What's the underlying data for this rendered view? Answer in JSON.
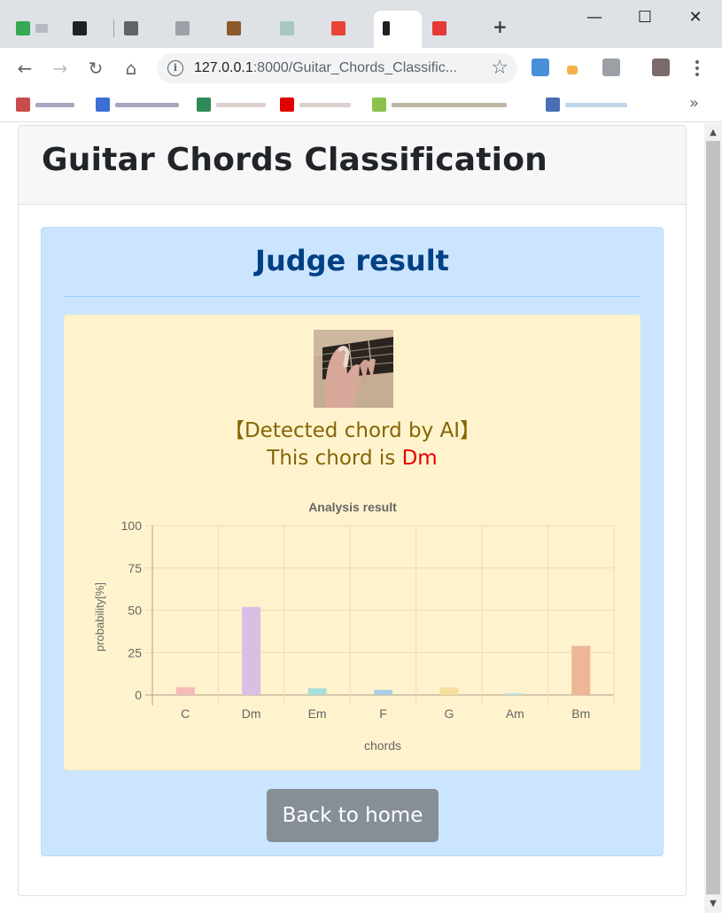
{
  "browser": {
    "url_host": "127.0.0.1",
    "url_rest": ":8000/Guitar_Chords_Classific...",
    "window_controls": [
      "minimize",
      "maximize",
      "close"
    ],
    "window_symbols": {
      "minimize": "—",
      "maximize": "☐",
      "close": "✕"
    },
    "nav_symbols": {
      "back": "←",
      "forward": "→",
      "reload": "↻",
      "home": "⌂",
      "star": "☆",
      "info": "i",
      "more": "»",
      "new_tab": "+"
    }
  },
  "page": {
    "title": "Guitar Chords Classification",
    "result_heading": "Judge result",
    "detected_label": "【Detected chord by AI】",
    "detected_prefix": "This chord is ",
    "detected_chord": "Dm",
    "home_button": "Back to home"
  },
  "colors": {
    "primary_alert_bg": "#cce5ff",
    "warning_alert_bg": "#fff3cd",
    "heading_blue": "#004085",
    "chord_red": "#e60000",
    "button_gray": "#868e96"
  },
  "chart_data": {
    "type": "bar",
    "title": "Analysis result",
    "xlabel": "chords",
    "ylabel": "probability[%]",
    "categories": [
      "C",
      "Dm",
      "Em",
      "F",
      "G",
      "Am",
      "Bm"
    ],
    "values": [
      4.5,
      52,
      4,
      3,
      4.5,
      1,
      29
    ],
    "colors": [
      "#f4b9b9",
      "#d9bfe6",
      "#a9dfd8",
      "#a8cfe4",
      "#f7dd9c",
      "#bfe3e8",
      "#edb797"
    ],
    "ylim": [
      0,
      100
    ],
    "yticks": [
      0,
      25,
      50,
      75,
      100
    ],
    "grid": true,
    "legend": "none"
  }
}
